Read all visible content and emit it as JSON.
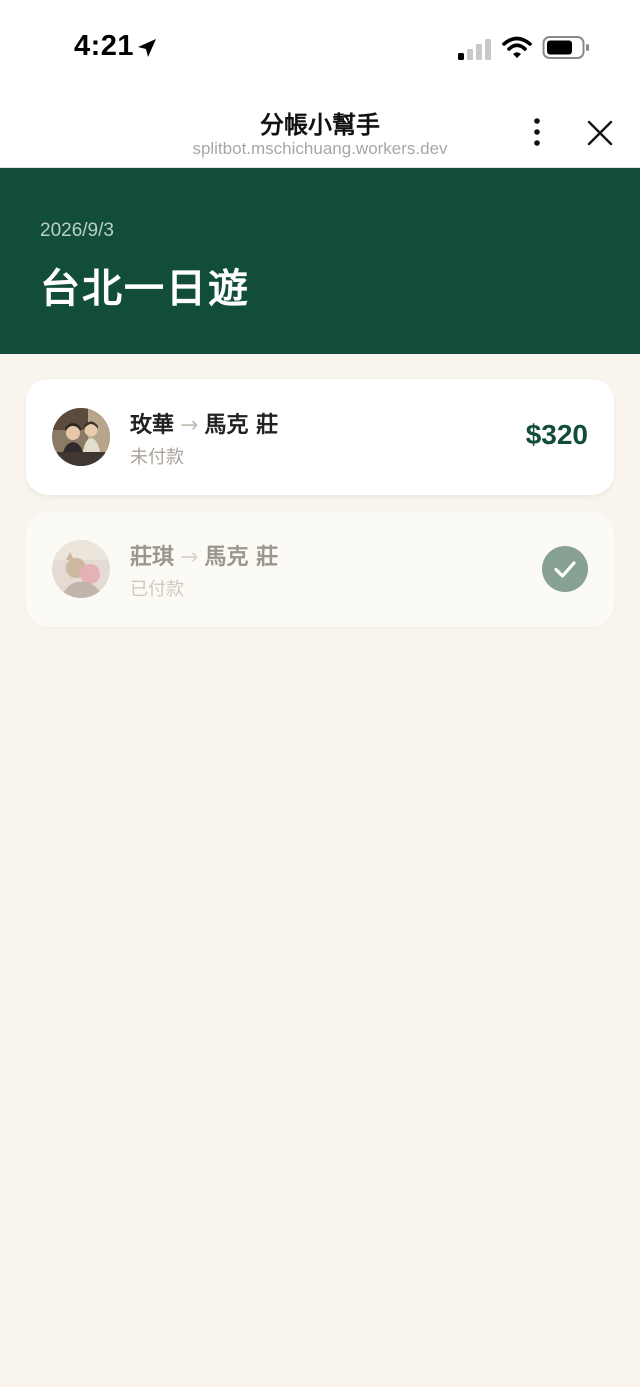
{
  "status_bar": {
    "time": "4:21"
  },
  "header": {
    "title": "分帳小幫手",
    "url": "splitbot.mschichuang.workers.dev"
  },
  "event": {
    "date": "2026/9/3",
    "title": "台北一日遊"
  },
  "settlements": [
    {
      "from": "玫華",
      "arrow": "→",
      "to": "馬克 莊",
      "status": "未付款",
      "amount": "$320",
      "paid": false
    },
    {
      "from": "莊琪",
      "arrow": "→",
      "to": "馬克 莊",
      "status": "已付款",
      "paid": true
    }
  ],
  "colors": {
    "brand_green": "#124c3b",
    "page_background": "#f9f5ee",
    "paid_check": "#87a195"
  },
  "icons": [
    "location-arrow-icon",
    "signal-icon",
    "wifi-icon",
    "battery-icon",
    "more-vertical-icon",
    "close-icon",
    "check-icon"
  ]
}
